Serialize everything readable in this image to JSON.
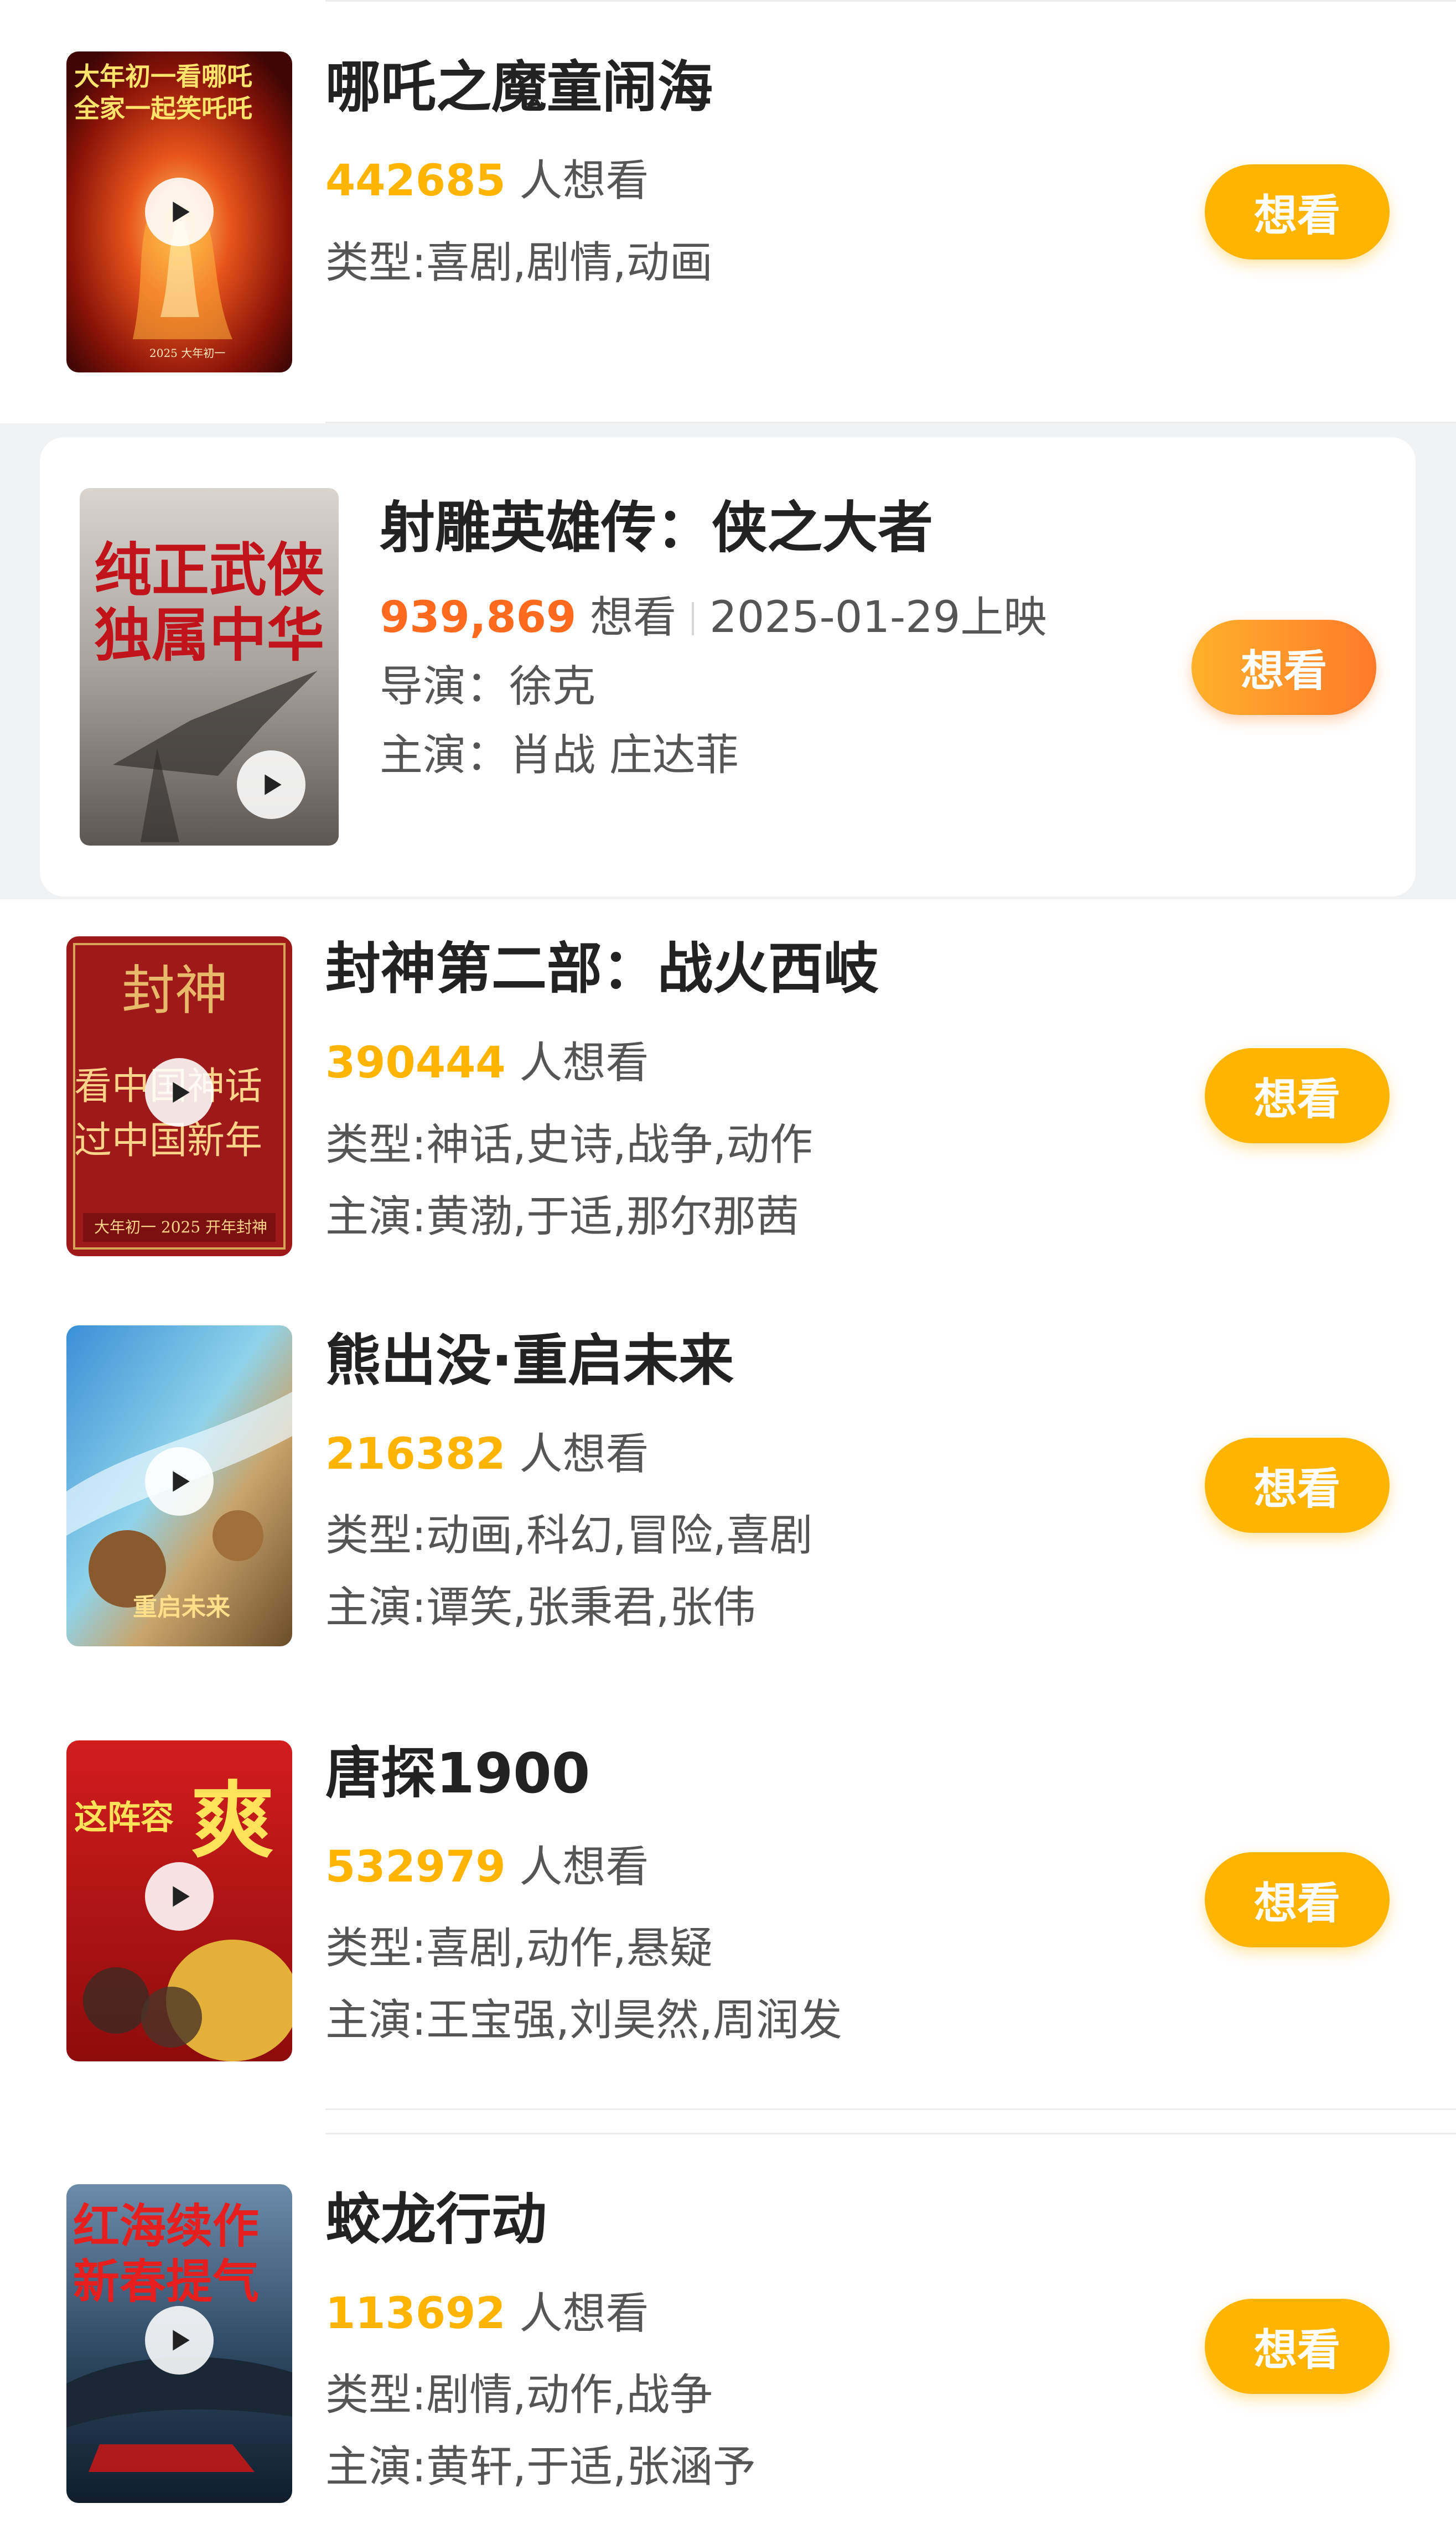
{
  "colors": {
    "accent": "#ffb400",
    "accent_gradient_end": "#ff7a2a",
    "highlight_count": "#ff6a1f",
    "band": "#f1f2f4"
  },
  "icons": {
    "play": "play-icon"
  },
  "movies": [
    {
      "title": "哪吒之魔童闹海",
      "count": "442685",
      "count_suffix": "人想看",
      "genre": "类型:喜剧,剧情,动画",
      "button": "想看",
      "poster": {
        "line1": "大年初一看哪吒",
        "line2": "全家一起笑吒吒",
        "badge": "2025 大年初一"
      }
    },
    {
      "title": "射雕英雄传：侠之大者",
      "count": "939,869",
      "count_suffix": "想看",
      "release": "2025-01-29上映",
      "director": "导演：徐克",
      "cast": "主演：肖战 庄达菲",
      "button": "想看",
      "poster": {
        "line1": "纯正武侠",
        "line2": "独属中华"
      }
    },
    {
      "title": "封神第二部：战火西岐",
      "count": "390444",
      "count_suffix": "人想看",
      "genre": "类型:神话,史诗,战争,动作",
      "cast": "主演:黄渤,于适,那尔那茜",
      "button": "想看",
      "poster": {
        "logo": "封神",
        "line1": "看中国神话",
        "line2": "过中国新年",
        "badge": "大年初一 2025 开年封神"
      }
    },
    {
      "title": "熊出没·重启未来",
      "count": "216382",
      "count_suffix": "人想看",
      "genre": "类型:动画,科幻,冒险,喜剧",
      "cast": "主演:谭笑,张秉君,张伟",
      "button": "想看",
      "poster": {
        "logo": "重启未来"
      }
    },
    {
      "title": "唐探1900",
      "count": "532979",
      "count_suffix": "人想看",
      "genre": "类型:喜剧,动作,悬疑",
      "cast": "主演:王宝强,刘昊然,周润发",
      "button": "想看",
      "poster": {
        "line1": "这阵容",
        "big": "爽"
      }
    },
    {
      "title": "蛟龙行动",
      "count": "113692",
      "count_suffix": "人想看",
      "genre": "类型:剧情,动作,战争",
      "cast": "主演:黄轩,于适,张涵予",
      "button": "想看",
      "poster": {
        "line1": "红海续作",
        "line2": "新春提气"
      }
    }
  ]
}
